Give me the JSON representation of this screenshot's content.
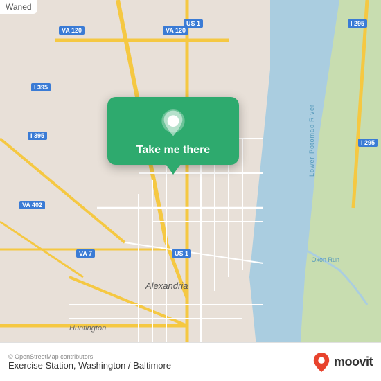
{
  "map": {
    "title": "Exercise Station, Washington / Baltimore",
    "tab_label": "Waned",
    "copyright": "© OpenStreetMap contributors",
    "river_label": "Lower Potomac River",
    "oxon_label": "Oxon Run",
    "city_label": "Alexandria",
    "huntington_label": "Huntington",
    "tooltip_button_text": "Take me there",
    "colors": {
      "map_bg": "#e8e0d8",
      "water": "#aacde0",
      "green_land": "#c8ddb0",
      "road_yellow": "#f5c842",
      "road_label_bg": "#3a7bd5",
      "tooltip_green": "#2eaa6e",
      "tooltip_text": "#ffffff"
    },
    "road_labels": [
      "VA 120",
      "US 1",
      "I 395",
      "I 295",
      "VA 402",
      "VA 7",
      "US 1"
    ],
    "moovit": {
      "text": "moovit"
    }
  }
}
